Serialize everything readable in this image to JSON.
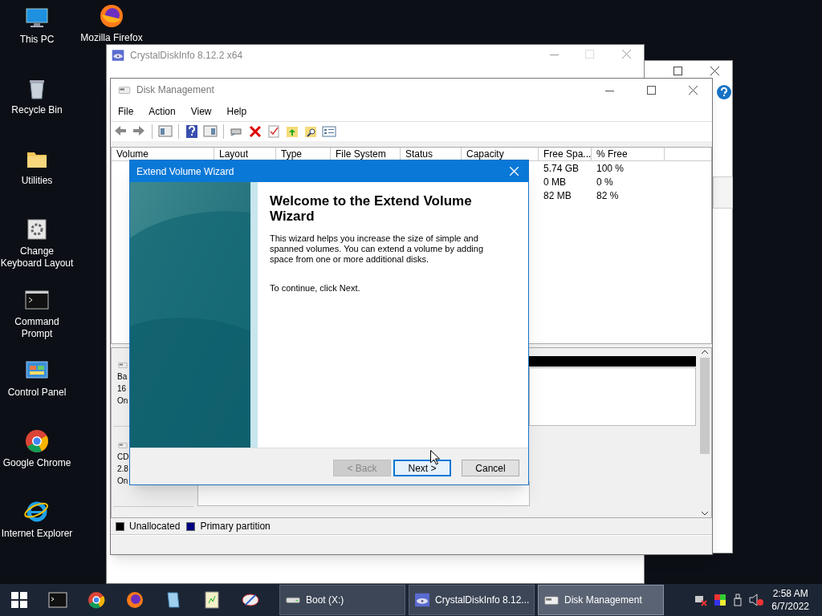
{
  "desktop_icons": [
    {
      "label": "This PC",
      "kind": "pc"
    },
    {
      "label": "Recycle Bin",
      "kind": "bin"
    },
    {
      "label": "Utilities",
      "kind": "folder"
    },
    {
      "label": "Change Keyboard Layout",
      "kind": "gear"
    },
    {
      "label": "Command Prompt",
      "kind": "terminal"
    },
    {
      "label": "Control Panel",
      "kind": "panel"
    },
    {
      "label": "Google Chrome",
      "kind": "chrome"
    },
    {
      "label": "Internet Explorer",
      "kind": "ie"
    }
  ],
  "desktop_top_icon": {
    "label": "Mozilla Firefox",
    "kind": "firefox"
  },
  "crystaldiskinfo_window": {
    "title": "CrystalDiskInfo 8.12.2 x64"
  },
  "disk_management": {
    "title": "Disk Management",
    "menu": [
      "File",
      "Action",
      "View",
      "Help"
    ],
    "columns": [
      "Volume",
      "Layout",
      "Type",
      "File System",
      "Status",
      "Capacity",
      "Free Spa...",
      "% Free"
    ],
    "rows": [
      {
        "free_space": "5.74 GB",
        "percent_free": "100 %"
      },
      {
        "free_space": "0 MB",
        "percent_free": "0 %"
      },
      {
        "free_space": "82 MB",
        "percent_free": "82 %"
      }
    ],
    "disks": [
      {
        "lines": [
          "Ba",
          "16",
          "On"
        ]
      },
      {
        "lines": [
          "CD",
          "2.8",
          "On"
        ]
      }
    ],
    "legend": [
      {
        "label": "Unallocated",
        "color": "#000000"
      },
      {
        "label": "Primary partition",
        "color": "#000080"
      }
    ]
  },
  "wizard": {
    "title": "Extend Volume Wizard",
    "heading": "Welcome to the Extend Volume Wizard",
    "body": "This wizard helps you increase the size of simple and spanned volumes. You can extend a volume  by adding space from one or more additional disks.",
    "hint": "To continue, click Next.",
    "buttons": [
      {
        "label": "< Back",
        "disabled": true,
        "default": false
      },
      {
        "label": "Next >",
        "disabled": false,
        "default": true
      },
      {
        "label": "Cancel",
        "disabled": false,
        "default": false
      }
    ]
  },
  "taskbar": {
    "windows": [
      {
        "label": "Boot (X:)",
        "kind": "drive",
        "active": false
      },
      {
        "label": "CrystalDiskInfo 8.12...",
        "kind": "crystal",
        "active": false
      },
      {
        "label": "Disk Management",
        "kind": "diskmgmt",
        "active": true
      }
    ],
    "time": "2:58 AM",
    "date": "6/7/2022"
  }
}
